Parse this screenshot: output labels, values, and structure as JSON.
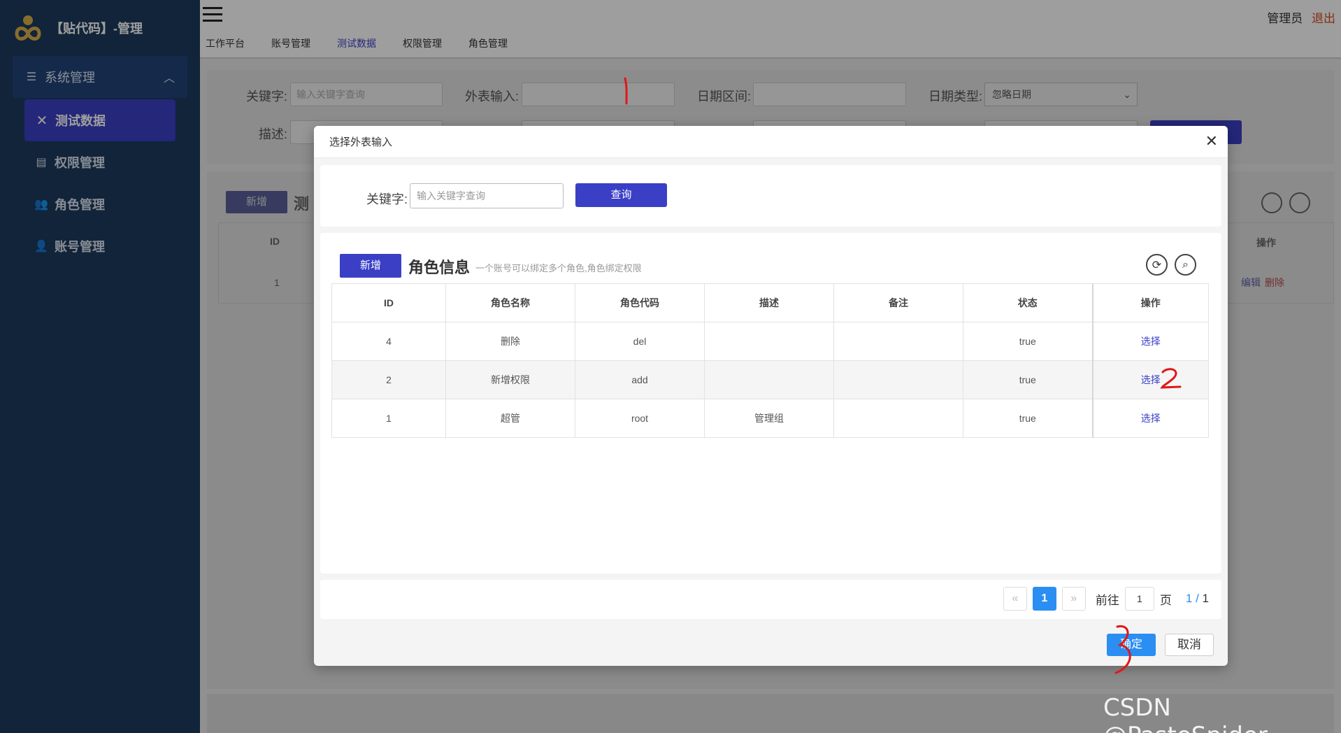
{
  "brand": {
    "title": "【贴代码】-管理"
  },
  "sidebar": {
    "group_label": "系统管理",
    "items": [
      {
        "label": "测试数据",
        "active": true
      },
      {
        "label": "权限管理"
      },
      {
        "label": "角色管理"
      },
      {
        "label": "账号管理"
      }
    ]
  },
  "topbar": {
    "tabs": [
      "工作平台",
      "账号管理",
      "测试数据",
      "权限管理",
      "角色管理"
    ],
    "active_tab": "测试数据",
    "user": "管理员",
    "logout": "退出"
  },
  "background_page": {
    "keyword_label": "关键字:",
    "keyword_placeholder": "输入关键字查询",
    "foreign_label": "外表输入:",
    "date_range_label": "日期区间:",
    "date_type_label": "日期类型:",
    "date_type_value": "忽略日期",
    "desc_label": "描述:",
    "new_label": "新增",
    "title_fragment": "测",
    "col_id": "ID",
    "col_op": "操作",
    "row_id": "1",
    "edit_label": "编辑",
    "delete_label": "删除"
  },
  "modal": {
    "title": "选择外表输入",
    "close_icon": "close-icon",
    "keyword_label": "关键字:",
    "keyword_placeholder": "输入关键字查询",
    "query_label": "查询",
    "new_label": "新增",
    "list_title": "角色信息",
    "list_subtitle": "一个账号可以绑定多个角色,角色绑定权限",
    "columns": [
      "ID",
      "角色名称",
      "角色代码",
      "描述",
      "备注",
      "状态",
      "操作"
    ],
    "rows": [
      {
        "id": "4",
        "name": "删除",
        "code": "del",
        "desc": "",
        "remark": "",
        "status": "true",
        "op": "选择"
      },
      {
        "id": "2",
        "name": "新增权限",
        "code": "add",
        "desc": "",
        "remark": "",
        "status": "true",
        "op": "选择"
      },
      {
        "id": "1",
        "name": "超管",
        "code": "root",
        "desc": "管理组",
        "remark": "",
        "status": "true",
        "op": "选择"
      }
    ],
    "pagination": {
      "prev": "«",
      "current": "1",
      "next": "»",
      "goto_label": "前往",
      "goto_value": "1",
      "page_label": "页",
      "current_page": "1",
      "separator": "/",
      "total_pages": "1"
    },
    "ok_label": "确定",
    "cancel_label": "取消"
  },
  "annotations": [
    "1",
    "2",
    "3"
  ],
  "watermark": "CSDN @PasteSpider",
  "colors": {
    "primary": "#3a3fc6",
    "sidebar": "#1c3a5e",
    "accent_blue": "#2a8ef2",
    "logout": "#d24a1e"
  }
}
